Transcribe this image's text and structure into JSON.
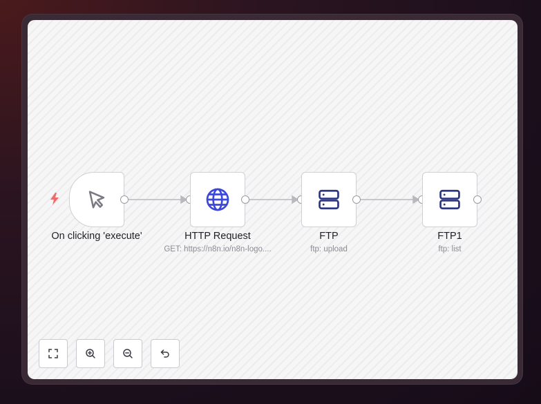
{
  "workflow": {
    "nodes": [
      {
        "name": "On clicking 'execute'",
        "subtitle": "",
        "icon": "cursor-icon"
      },
      {
        "name": "HTTP Request",
        "subtitle": "GET: https://n8n.io/n8n-logo....",
        "icon": "globe-icon"
      },
      {
        "name": "FTP",
        "subtitle": "ftp: upload",
        "icon": "server-icon"
      },
      {
        "name": "FTP1",
        "subtitle": "ftp: list",
        "icon": "server-icon"
      }
    ]
  },
  "controls": {
    "fit_view": {
      "icon": "fullscreen-icon"
    },
    "zoom_in": {
      "icon": "zoom-in-icon"
    },
    "zoom_out": {
      "icon": "zoom-out-icon"
    },
    "reset": {
      "icon": "undo-icon"
    }
  },
  "colors": {
    "trigger_bolt": "#ef6b6b",
    "globe": "#3b47d8",
    "server": "#2c3580",
    "edge": "#b8b8be"
  }
}
